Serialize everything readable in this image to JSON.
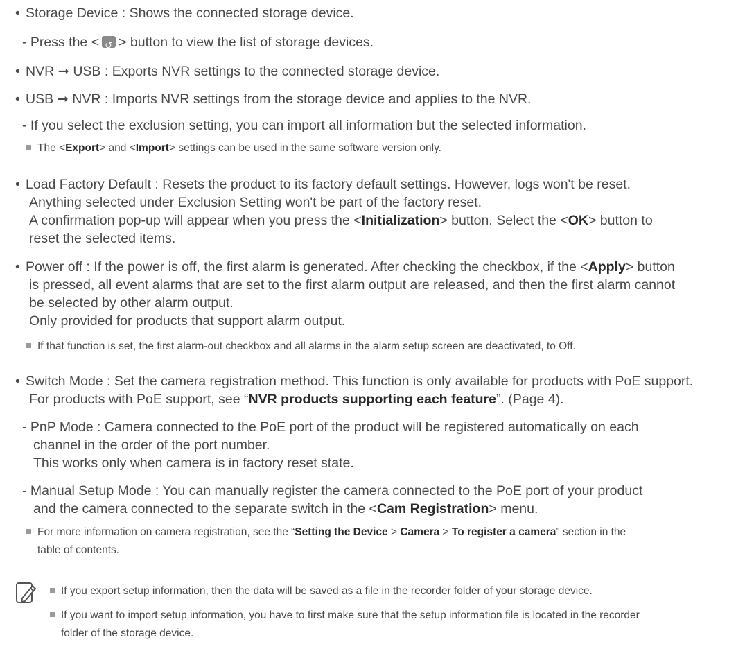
{
  "items": {
    "storage_device": "Storage Device : Shows the connected storage device.",
    "press_pre": "- Press the <",
    "press_post": "> button to view the list of storage devices.",
    "nvr_usb": "NVR ➞ USB : Exports NVR settings to the connected storage device.",
    "usb_nvr": "USB ➞ NVR : Imports NVR settings from the storage device and applies to the NVR.",
    "exclusion": "- If you select the exclusion setting, you can import all information but the selected information.",
    "export_note_1": "The <",
    "export_note_export": "Export",
    "export_note_2": "> and <",
    "export_note_import": "Import",
    "export_note_3": "> settings can be used in the same software version only.",
    "load_factory_1": "Load Factory Default : Resets the product to its factory default settings. However, logs won't be reset.",
    "load_factory_2": "Anything selected under Exclusion Setting won't be part of the factory reset.",
    "load_factory_3a": "A confirmation pop-up will appear when you press the <",
    "load_factory_init": "Initialization",
    "load_factory_3b": "> button. Select the <",
    "load_factory_ok": "OK",
    "load_factory_3c": "> button to",
    "load_factory_4": "reset the selected items.",
    "power_off_1a": "Power off : If the power is off, the first alarm is generated. After checking the checkbox, if the <",
    "power_off_apply": "Apply",
    "power_off_1b": "> button",
    "power_off_2": "is pressed, all event alarms that are set to the first alarm output are released, and then the first alarm cannot",
    "power_off_3": "be selected by other alarm output.",
    "power_off_4": "Only provided for products that support alarm output.",
    "power_off_note": "If that function is set, the first alarm-out checkbox and all alarms in the alarm setup screen are deactivated, to Off.",
    "switch_1": "Switch Mode : Set the camera registration method. This function is only available for products with PoE support.",
    "switch_2a": "For products with PoE support, see “",
    "switch_2_bold": "NVR products supporting each feature",
    "switch_2b": "”. (Page 4).",
    "pnp_1": "- PnP Mode : Camera connected to the PoE port of the product will be registered automatically on each",
    "pnp_2": "channel in the order of the port number.",
    "pnp_3": "This works only when camera is in factory reset state.",
    "manual_1": "- Manual Setup Mode : You can manually register the camera connected to the PoE port of your product",
    "manual_2a": "and the camera connected to the separate switch in the <",
    "manual_2_bold": "Cam Registration",
    "manual_2b": "> menu.",
    "more_1a": "For more information on camera registration, see the “",
    "more_b1": "Setting the Device",
    "more_sep1": " > ",
    "more_b2": "Camera",
    "more_sep2": " > ",
    "more_b3": "To register a camera",
    "more_1b": "” section in the",
    "more_2": "table of contents.",
    "memo_1": "If you export setup information, then the data will be saved as a file in the recorder folder of your storage device.",
    "memo_2": "If you want to import setup information, you have to first make sure that the setup information file is located in the recorder",
    "memo_3": "folder of the storage device."
  },
  "icons": {
    "bullet": "•",
    "note_marker": "square-bullet",
    "memo": "pencil-note-icon",
    "button": "return-button-icon"
  }
}
